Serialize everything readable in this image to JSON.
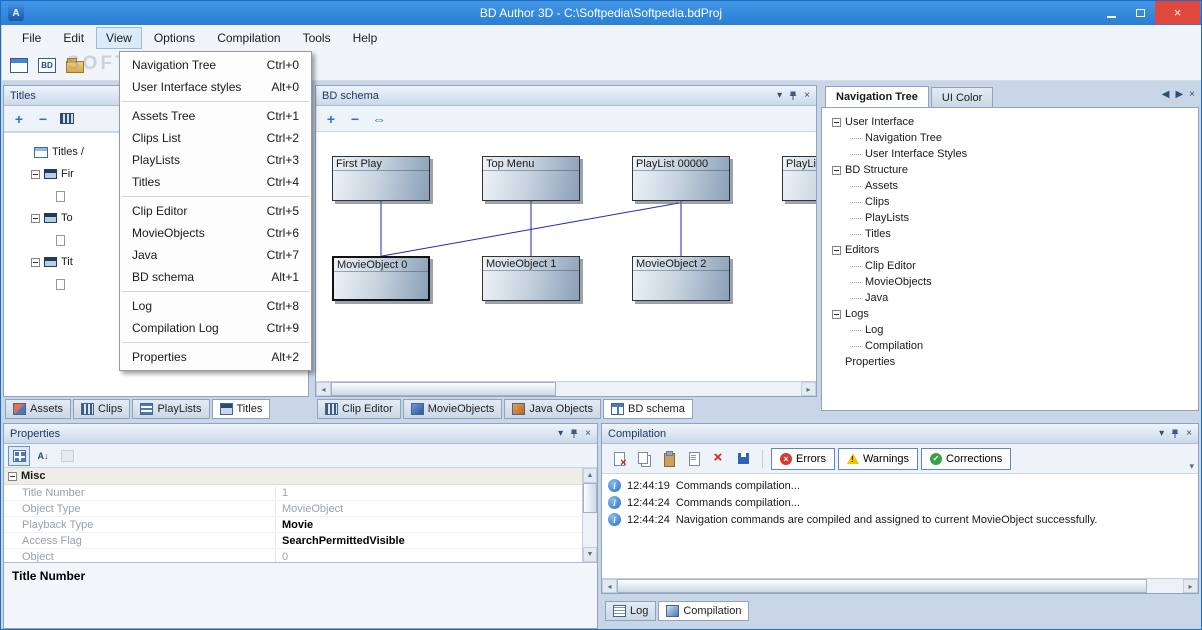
{
  "window": {
    "title": "BD Author 3D - C:\\Softpedia\\Softpedia.bdProj",
    "app_initial": "A"
  },
  "watermark": "SOFTPEDIA",
  "icons": {
    "close": "×",
    "close_small": "×",
    "plus": "+",
    "minus": "−",
    "swap": "⇔",
    "menu_arrow": "▾",
    "arrow_left": "◀",
    "arrow_right": "▶",
    "arrow_up": "▲",
    "arrow_down": "▼",
    "scroll_left": "◂",
    "scroll_right": "▸",
    "overflow": "▾"
  },
  "menu_bar": {
    "items": [
      {
        "label": "File"
      },
      {
        "label": "Edit"
      },
      {
        "label": "View",
        "active": true
      },
      {
        "label": "Options"
      },
      {
        "label": "Compilation"
      },
      {
        "label": "Tools"
      },
      {
        "label": "Help"
      }
    ]
  },
  "view_menu": {
    "items": [
      {
        "label": "Navigation Tree",
        "shortcut": "Ctrl+0"
      },
      {
        "label": "User Interface styles",
        "shortcut": "Alt+0"
      },
      {
        "label": "Assets Tree",
        "shortcut": "Ctrl+1"
      },
      {
        "label": "Clips List",
        "shortcut": "Ctrl+2"
      },
      {
        "label": "PlayLists",
        "shortcut": "Ctrl+3"
      },
      {
        "label": "Titles",
        "shortcut": "Ctrl+4"
      },
      {
        "label": "Clip Editor",
        "shortcut": "Ctrl+5"
      },
      {
        "label": "MovieObjects",
        "shortcut": "Ctrl+6"
      },
      {
        "label": "Java",
        "shortcut": "Ctrl+7"
      },
      {
        "label": "BD schema",
        "shortcut": "Alt+1"
      },
      {
        "label": "Log",
        "shortcut": "Ctrl+8"
      },
      {
        "label": "Compilation Log",
        "shortcut": "Ctrl+9"
      },
      {
        "label": "Properties",
        "shortcut": "Alt+2"
      }
    ]
  },
  "titles_panel": {
    "title": "Titles",
    "root_label": "Titles /",
    "items": [
      {
        "label": "Fir"
      },
      {
        "label": "To"
      },
      {
        "label": "Tit"
      }
    ]
  },
  "left_tabs": {
    "items": [
      {
        "label": "Assets"
      },
      {
        "label": "Clips"
      },
      {
        "label": "PlayLists"
      },
      {
        "label": "Titles",
        "selected": true
      }
    ]
  },
  "schema_panel": {
    "title": "BD schema",
    "boxes": [
      {
        "label": "First Play"
      },
      {
        "label": "Top Menu"
      },
      {
        "label": "PlayList 00000"
      },
      {
        "label": "PlayLi"
      },
      {
        "label": "MovieObject 0"
      },
      {
        "label": "MovieObject 1"
      },
      {
        "label": "MovieObject 2"
      }
    ]
  },
  "center_tabs": {
    "items": [
      {
        "label": "Clip Editor"
      },
      {
        "label": "MovieObjects"
      },
      {
        "label": "Java Objects"
      },
      {
        "label": "BD schema",
        "selected": true
      }
    ]
  },
  "nav_panel": {
    "tabs": [
      {
        "label": "Navigation Tree",
        "selected": true
      },
      {
        "label": "UI Color"
      }
    ],
    "tree": [
      {
        "label": "User Interface",
        "level": 0,
        "expanded": true
      },
      {
        "label": "Navigation Tree",
        "level": 1
      },
      {
        "label": "User Interface Styles",
        "level": 1
      },
      {
        "label": "BD Structure",
        "level": 0,
        "expanded": true
      },
      {
        "label": "Assets",
        "level": 1
      },
      {
        "label": "Clips",
        "level": 1
      },
      {
        "label": "PlayLists",
        "level": 1
      },
      {
        "label": "Titles",
        "level": 1
      },
      {
        "label": "Editors",
        "level": 0,
        "expanded": true
      },
      {
        "label": "Clip Editor",
        "level": 1
      },
      {
        "label": "MovieObjects",
        "level": 1
      },
      {
        "label": "Java",
        "level": 1
      },
      {
        "label": "Logs",
        "level": 0,
        "expanded": true
      },
      {
        "label": "Log",
        "level": 1
      },
      {
        "label": "Compilation",
        "level": 1
      },
      {
        "label": "Properties",
        "level": 0
      }
    ]
  },
  "properties_panel": {
    "title": "Properties",
    "category": "Misc",
    "rows": [
      {
        "label": "Title Number",
        "value": "1",
        "bold": false
      },
      {
        "label": "Object Type",
        "value": "MovieObject",
        "bold": false
      },
      {
        "label": "Playback Type",
        "value": "Movie",
        "bold": true
      },
      {
        "label": "Access Flag",
        "value": "SearchPermittedVisible",
        "bold": true
      },
      {
        "label": "Object",
        "value": "0",
        "bold": false
      }
    ],
    "description_title": "Title Number"
  },
  "compilation_panel": {
    "title": "Compilation",
    "filter_buttons": [
      {
        "label": "Errors"
      },
      {
        "label": "Warnings"
      },
      {
        "label": "Corrections"
      }
    ],
    "log": [
      {
        "time": "12:44:19",
        "text": "Commands compilation..."
      },
      {
        "time": "12:44:24",
        "text": "Commands compilation..."
      },
      {
        "time": "12:44:24",
        "text": "Navigation commands are compiled and assigned to current MovieObject successfully."
      }
    ],
    "tabs": [
      {
        "label": "Log"
      },
      {
        "label": "Compilation",
        "selected": true
      }
    ]
  }
}
